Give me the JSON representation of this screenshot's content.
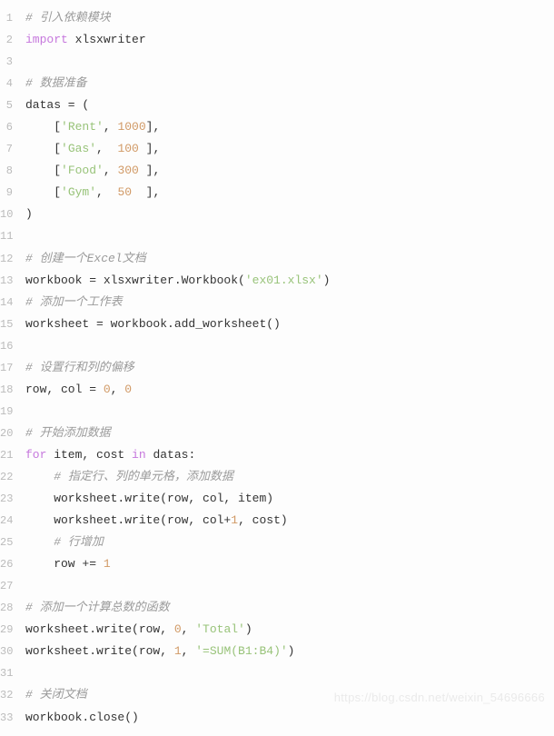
{
  "lines": [
    {
      "n": "1",
      "tokens": [
        {
          "t": "# 引入依赖模块",
          "c": "comment"
        }
      ]
    },
    {
      "n": "2",
      "tokens": [
        {
          "t": "import",
          "c": "keyword"
        },
        {
          "t": " xlsxwriter",
          "c": "builtin"
        }
      ]
    },
    {
      "n": "3",
      "tokens": []
    },
    {
      "n": "4",
      "tokens": [
        {
          "t": "# 数据准备",
          "c": "comment"
        }
      ]
    },
    {
      "n": "5",
      "tokens": [
        {
          "t": "datas = (",
          "c": "builtin"
        }
      ]
    },
    {
      "n": "6",
      "tokens": [
        {
          "t": "    [",
          "c": "builtin"
        },
        {
          "t": "'Rent'",
          "c": "string"
        },
        {
          "t": ", ",
          "c": "builtin"
        },
        {
          "t": "1000",
          "c": "number"
        },
        {
          "t": "],",
          "c": "builtin"
        }
      ]
    },
    {
      "n": "7",
      "tokens": [
        {
          "t": "    [",
          "c": "builtin"
        },
        {
          "t": "'Gas'",
          "c": "string"
        },
        {
          "t": ",  ",
          "c": "builtin"
        },
        {
          "t": "100",
          "c": "number"
        },
        {
          "t": " ],",
          "c": "builtin"
        }
      ]
    },
    {
      "n": "8",
      "tokens": [
        {
          "t": "    [",
          "c": "builtin"
        },
        {
          "t": "'Food'",
          "c": "string"
        },
        {
          "t": ", ",
          "c": "builtin"
        },
        {
          "t": "300",
          "c": "number"
        },
        {
          "t": " ],",
          "c": "builtin"
        }
      ]
    },
    {
      "n": "9",
      "tokens": [
        {
          "t": "    [",
          "c": "builtin"
        },
        {
          "t": "'Gym'",
          "c": "string"
        },
        {
          "t": ",  ",
          "c": "builtin"
        },
        {
          "t": "50",
          "c": "number"
        },
        {
          "t": "  ],",
          "c": "builtin"
        }
      ]
    },
    {
      "n": "10",
      "tokens": [
        {
          "t": ")",
          "c": "builtin"
        }
      ]
    },
    {
      "n": "11",
      "tokens": []
    },
    {
      "n": "12",
      "tokens": [
        {
          "t": "# 创建一个Excel文档",
          "c": "comment"
        }
      ]
    },
    {
      "n": "13",
      "tokens": [
        {
          "t": "workbook = xlsxwriter.Workbook(",
          "c": "builtin"
        },
        {
          "t": "'ex01.xlsx'",
          "c": "string"
        },
        {
          "t": ")",
          "c": "builtin"
        }
      ]
    },
    {
      "n": "14",
      "tokens": [
        {
          "t": "# 添加一个工作表",
          "c": "comment"
        }
      ]
    },
    {
      "n": "15",
      "tokens": [
        {
          "t": "worksheet = workbook.add_worksheet()",
          "c": "builtin"
        }
      ]
    },
    {
      "n": "16",
      "tokens": []
    },
    {
      "n": "17",
      "tokens": [
        {
          "t": "# 设置行和列的偏移",
          "c": "comment"
        }
      ]
    },
    {
      "n": "18",
      "tokens": [
        {
          "t": "row, col = ",
          "c": "builtin"
        },
        {
          "t": "0",
          "c": "number"
        },
        {
          "t": ", ",
          "c": "builtin"
        },
        {
          "t": "0",
          "c": "number"
        }
      ]
    },
    {
      "n": "19",
      "tokens": []
    },
    {
      "n": "20",
      "tokens": [
        {
          "t": "# 开始添加数据",
          "c": "comment"
        }
      ]
    },
    {
      "n": "21",
      "tokens": [
        {
          "t": "for",
          "c": "keyword"
        },
        {
          "t": " item, cost ",
          "c": "builtin"
        },
        {
          "t": "in",
          "c": "keyword"
        },
        {
          "t": " datas:",
          "c": "builtin"
        }
      ]
    },
    {
      "n": "22",
      "tokens": [
        {
          "t": "    ",
          "c": "builtin"
        },
        {
          "t": "# 指定行、列的单元格，添加数据",
          "c": "comment"
        }
      ]
    },
    {
      "n": "23",
      "tokens": [
        {
          "t": "    worksheet.write(row, col, item)",
          "c": "builtin"
        }
      ]
    },
    {
      "n": "24",
      "tokens": [
        {
          "t": "    worksheet.write(row, col+",
          "c": "builtin"
        },
        {
          "t": "1",
          "c": "number"
        },
        {
          "t": ", cost)",
          "c": "builtin"
        }
      ]
    },
    {
      "n": "25",
      "tokens": [
        {
          "t": "    ",
          "c": "builtin"
        },
        {
          "t": "# 行增加",
          "c": "comment"
        }
      ]
    },
    {
      "n": "26",
      "tokens": [
        {
          "t": "    row += ",
          "c": "builtin"
        },
        {
          "t": "1",
          "c": "number"
        }
      ]
    },
    {
      "n": "27",
      "tokens": []
    },
    {
      "n": "28",
      "tokens": [
        {
          "t": "# 添加一个计算总数的函数",
          "c": "comment"
        }
      ]
    },
    {
      "n": "29",
      "tokens": [
        {
          "t": "worksheet.write(row, ",
          "c": "builtin"
        },
        {
          "t": "0",
          "c": "number"
        },
        {
          "t": ", ",
          "c": "builtin"
        },
        {
          "t": "'Total'",
          "c": "string"
        },
        {
          "t": ")",
          "c": "builtin"
        }
      ]
    },
    {
      "n": "30",
      "tokens": [
        {
          "t": "worksheet.write(row, ",
          "c": "builtin"
        },
        {
          "t": "1",
          "c": "number"
        },
        {
          "t": ", ",
          "c": "builtin"
        },
        {
          "t": "'=SUM(B1:B4)'",
          "c": "string"
        },
        {
          "t": ")",
          "c": "builtin"
        }
      ]
    },
    {
      "n": "31",
      "tokens": []
    },
    {
      "n": "32",
      "tokens": [
        {
          "t": "# 关闭文档",
          "c": "comment"
        }
      ]
    },
    {
      "n": "33",
      "tokens": [
        {
          "t": "workbook.close()",
          "c": "builtin"
        }
      ]
    }
  ],
  "watermark": "https://blog.csdn.net/weixin_54696666"
}
